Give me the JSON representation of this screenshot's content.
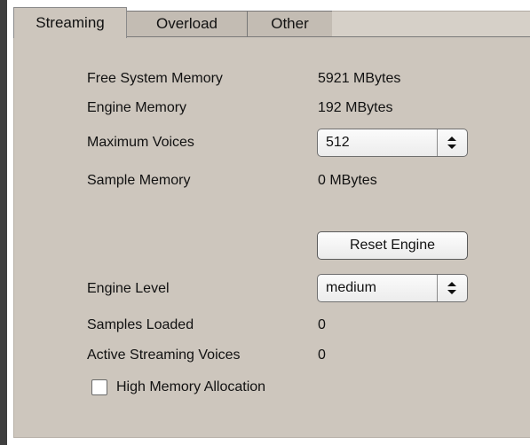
{
  "tabs": [
    {
      "label": "Streaming",
      "active": true
    },
    {
      "label": "Overload",
      "active": false
    },
    {
      "label": "Other",
      "active": false
    }
  ],
  "streaming": {
    "free_system_memory": {
      "label": "Free System Memory",
      "value": "5921 MBytes"
    },
    "engine_memory": {
      "label": "Engine Memory",
      "value": "192 MBytes"
    },
    "maximum_voices": {
      "label": "Maximum Voices",
      "selected": "512"
    },
    "sample_memory": {
      "label": "Sample Memory",
      "value": "0 MBytes"
    },
    "reset_engine_label": "Reset Engine",
    "engine_level": {
      "label": "Engine Level",
      "selected": "medium"
    },
    "samples_loaded": {
      "label": "Samples Loaded",
      "value": "0"
    },
    "active_streaming_voices": {
      "label": "Active Streaming Voices",
      "value": "0"
    },
    "high_memory_allocation": {
      "label": "High Memory Allocation",
      "checked": false
    }
  },
  "icons": {
    "select_arrows": "up-down-arrows-icon"
  }
}
